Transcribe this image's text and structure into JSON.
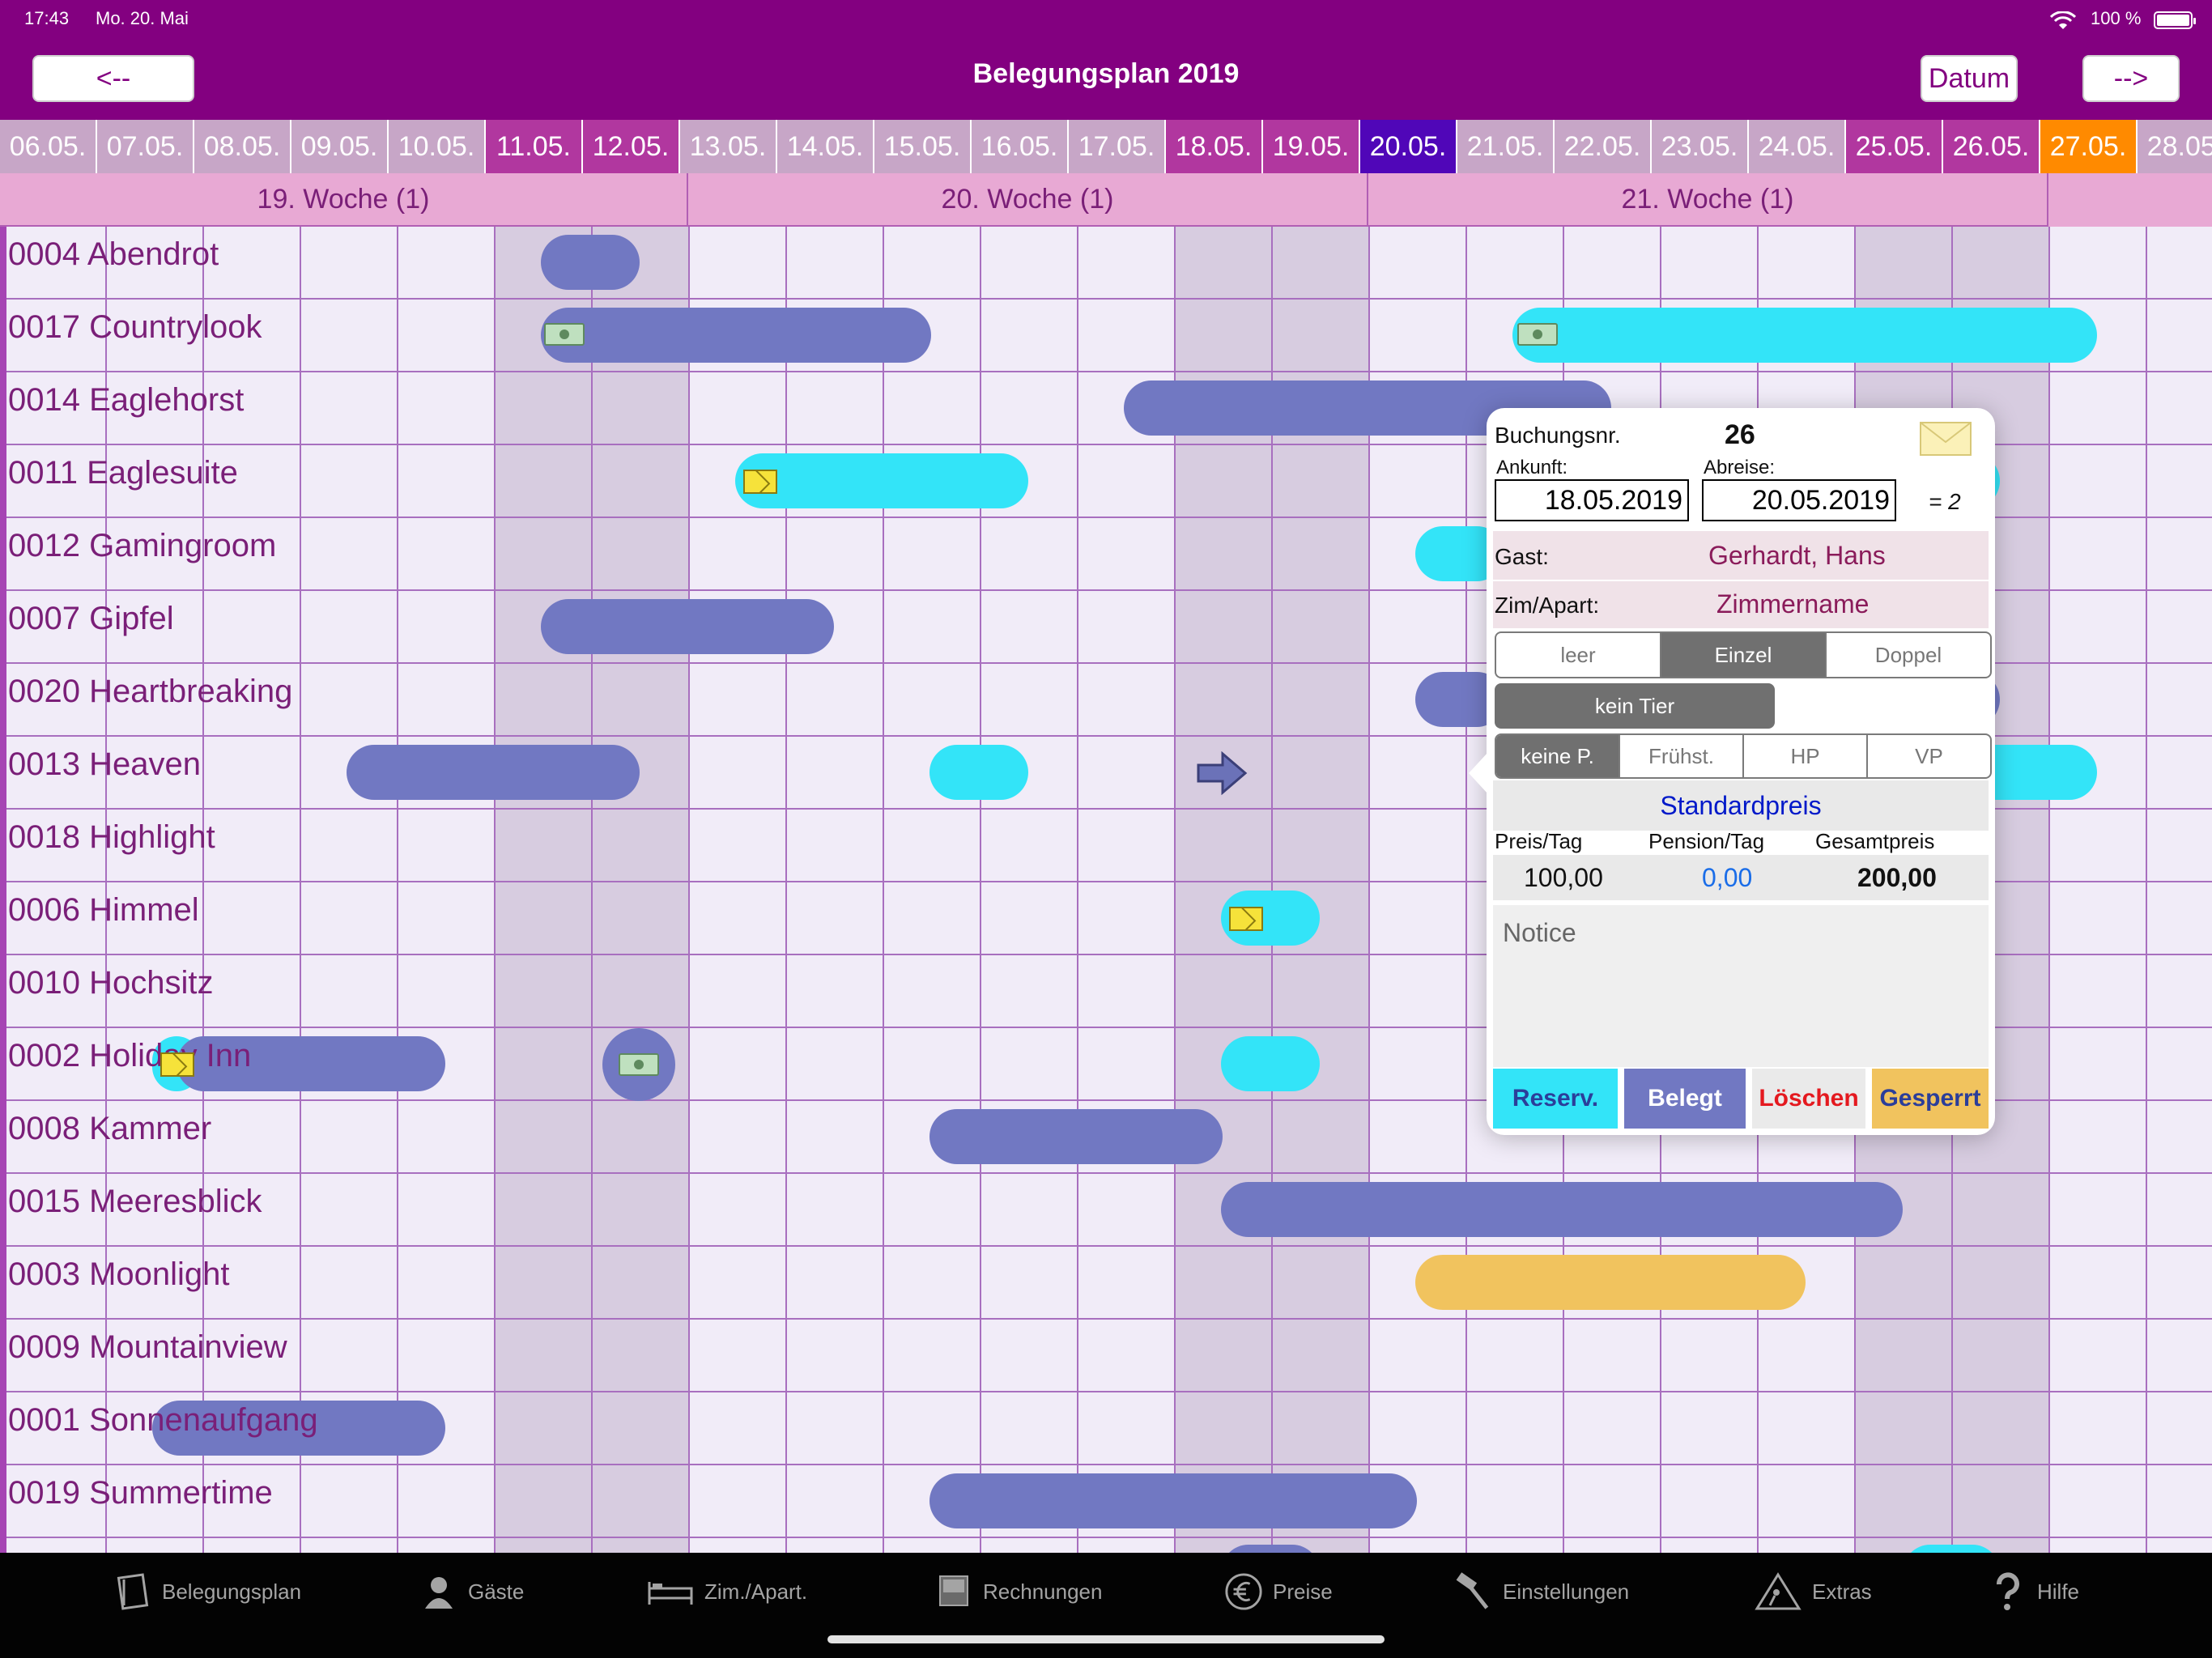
{
  "status": {
    "time": "17:43",
    "date": "Mo. 20. Mai",
    "battery": "100 %"
  },
  "nav": {
    "title": "Belegungsplan 2019",
    "back_label": "<--",
    "forward_label": "-->",
    "datum_label": "Datum"
  },
  "dates": [
    {
      "label": "06.05.",
      "kind": "normal"
    },
    {
      "label": "07.05.",
      "kind": "normal"
    },
    {
      "label": "08.05.",
      "kind": "normal"
    },
    {
      "label": "09.05.",
      "kind": "normal"
    },
    {
      "label": "10.05.",
      "kind": "normal"
    },
    {
      "label": "11.05.",
      "kind": "weekend"
    },
    {
      "label": "12.05.",
      "kind": "weekend"
    },
    {
      "label": "13.05.",
      "kind": "normal"
    },
    {
      "label": "14.05.",
      "kind": "normal"
    },
    {
      "label": "15.05.",
      "kind": "normal"
    },
    {
      "label": "16.05.",
      "kind": "normal"
    },
    {
      "label": "17.05.",
      "kind": "normal"
    },
    {
      "label": "18.05.",
      "kind": "weekend"
    },
    {
      "label": "19.05.",
      "kind": "weekend"
    },
    {
      "label": "20.05.",
      "kind": "today"
    },
    {
      "label": "21.05.",
      "kind": "normal"
    },
    {
      "label": "22.05.",
      "kind": "normal"
    },
    {
      "label": "23.05.",
      "kind": "normal"
    },
    {
      "label": "24.05.",
      "kind": "normal"
    },
    {
      "label": "25.05.",
      "kind": "weekend"
    },
    {
      "label": "26.05.",
      "kind": "weekend"
    },
    {
      "label": "27.05.",
      "kind": "holiday"
    },
    {
      "label": "28.05.",
      "kind": "normal"
    }
  ],
  "weeks": [
    "19. Woche (1)",
    "20. Woche (1)",
    "21. Woche (1)"
  ],
  "rooms": [
    "0004 Abendrot",
    "0017 Countrylook",
    "0014 Eaglehorst",
    "0011 Eaglesuite",
    "0012 Gamingroom",
    "0007 Gipfel",
    "0020 Heartbreaking",
    "0013 Heaven",
    "0018 Highlight",
    "0006 Himmel",
    "0010 Hochsitz",
    "0002 Holiday Inn",
    "0008 Kammer",
    "0015 Meeresblick",
    "0003 Moonlight",
    "0009 Mountainview",
    "0001 Sonnenaufgang",
    "0019 Summertime"
  ],
  "popover": {
    "buchungsnr_label": "Buchungsnr.",
    "buchungsnr": "26",
    "ankunft_label": "Ankunft:",
    "ankunft": "18.05.2019",
    "abreise_label": "Abreise:",
    "abreise": "20.05.2019",
    "nights": "= 2",
    "gast_label": "Gast:",
    "gast": "Gerhardt, Hans",
    "zim_label": "Zim/Apart:",
    "zim": "Zimmername",
    "occupancy": [
      "leer",
      "Einzel",
      "Doppel"
    ],
    "occupancy_selected": "Einzel",
    "tier": "kein Tier",
    "pension": [
      "keine P.",
      "Frühst.",
      "HP",
      "VP"
    ],
    "pension_selected": "keine P.",
    "price_mode": "Standardpreis",
    "preis_tag_label": "Preis/Tag",
    "pension_tag_label": "Pension/Tag",
    "gesamt_label": "Gesamtpreis",
    "preis_tag": "100,00",
    "pension_tag": "0,00",
    "gesamt": "200,00",
    "notice_placeholder": "Notice",
    "btn_reserv": "Reserv.",
    "btn_belegt": "Belegt",
    "btn_loeschen": "Löschen",
    "btn_gesperrt": "Gesperrt"
  },
  "tabs": [
    {
      "label": "Belegungsplan",
      "icon": "plan-book-icon"
    },
    {
      "label": "Gäste",
      "icon": "guest-icon"
    },
    {
      "label": "Zim./Apart.",
      "icon": "bed-icon"
    },
    {
      "label": "Rechnungen",
      "icon": "invoice-icon"
    },
    {
      "label": "Preise",
      "icon": "euro-icon"
    },
    {
      "label": "Einstellungen",
      "icon": "hammer-icon"
    },
    {
      "label": "Extras",
      "icon": "extras-icon"
    },
    {
      "label": "Hilfe",
      "icon": "help-icon"
    }
  ],
  "colors": {
    "header_purple": "#830080",
    "belegt": "#7178c2",
    "reserv": "#33e4f8",
    "gesperrt": "#f1c35e",
    "today": "#5006b8",
    "holiday": "#ff8a00",
    "weekend_header": "#b1379f",
    "weekday_header": "#c7a6c7"
  }
}
